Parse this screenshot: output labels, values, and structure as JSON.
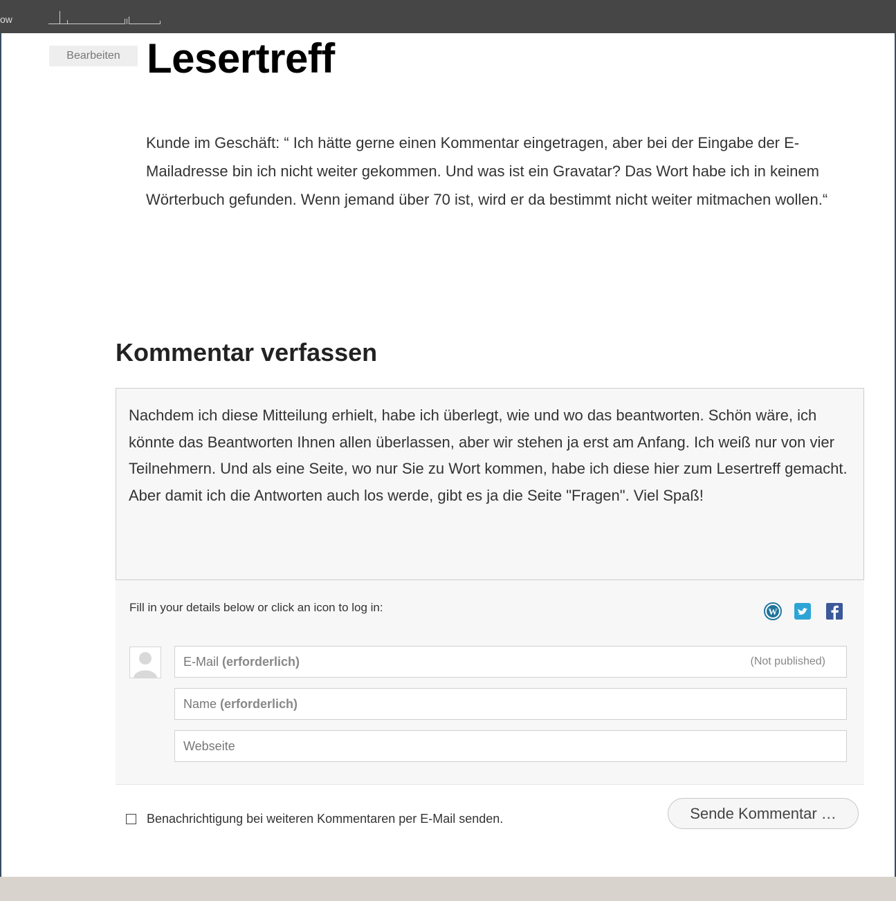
{
  "adminbar": {
    "label": "ow"
  },
  "page": {
    "edit_label": "Bearbeiten",
    "title": "Lesertreff",
    "intro": "Kunde im Geschäft: “ Ich hätte gerne einen Kommentar eingetragen, aber bei der Eingabe der E-Mailadresse bin ich nicht weiter gekommen. Und was ist ein Gravatar? Das Wort habe ich in keinem Wörterbuch gefunden. Wenn jemand über 70 ist, wird er da bestimmt nicht weiter mitmachen wollen.“"
  },
  "comment_form": {
    "heading": "Kommentar verfassen",
    "text": "Nachdem ich diese Mitteilung erhielt, habe ich überlegt, wie und wo das beantworten. Schön wäre, ich könnte das Beantworten Ihnen allen überlassen, aber wir stehen ja erst am Anfang. Ich weiß nur von vier Teilnehmern. Und als eine Seite, wo nur Sie zu Wort kommen, habe ich diese hier zum Lesertreff gemacht. Aber damit ich die Antworten auch los werde, gibt es ja die Seite \"Fragen\". Viel Spaß!",
    "login_hint": "Fill in your details below or click an icon to log in:",
    "login_icons": [
      "wordpress-icon",
      "twitter-icon",
      "facebook-icon"
    ],
    "email_label": "E-Mail",
    "email_required": "(erforderlich)",
    "email_note": "(Not published)",
    "name_label": "Name",
    "name_required": "(erforderlich)",
    "website_label": "Webseite",
    "subscribe_label": "Benachrichtigung bei weiteren Kommentaren per E-Mail senden.",
    "subscribe_checked": false,
    "submit_label": "Sende Kommentar …"
  },
  "colors": {
    "adminbar": "#464646",
    "wordpress": "#21759b",
    "twitter": "#2ea4d6",
    "facebook": "#3b5998",
    "footer": "#d8d4cd"
  }
}
